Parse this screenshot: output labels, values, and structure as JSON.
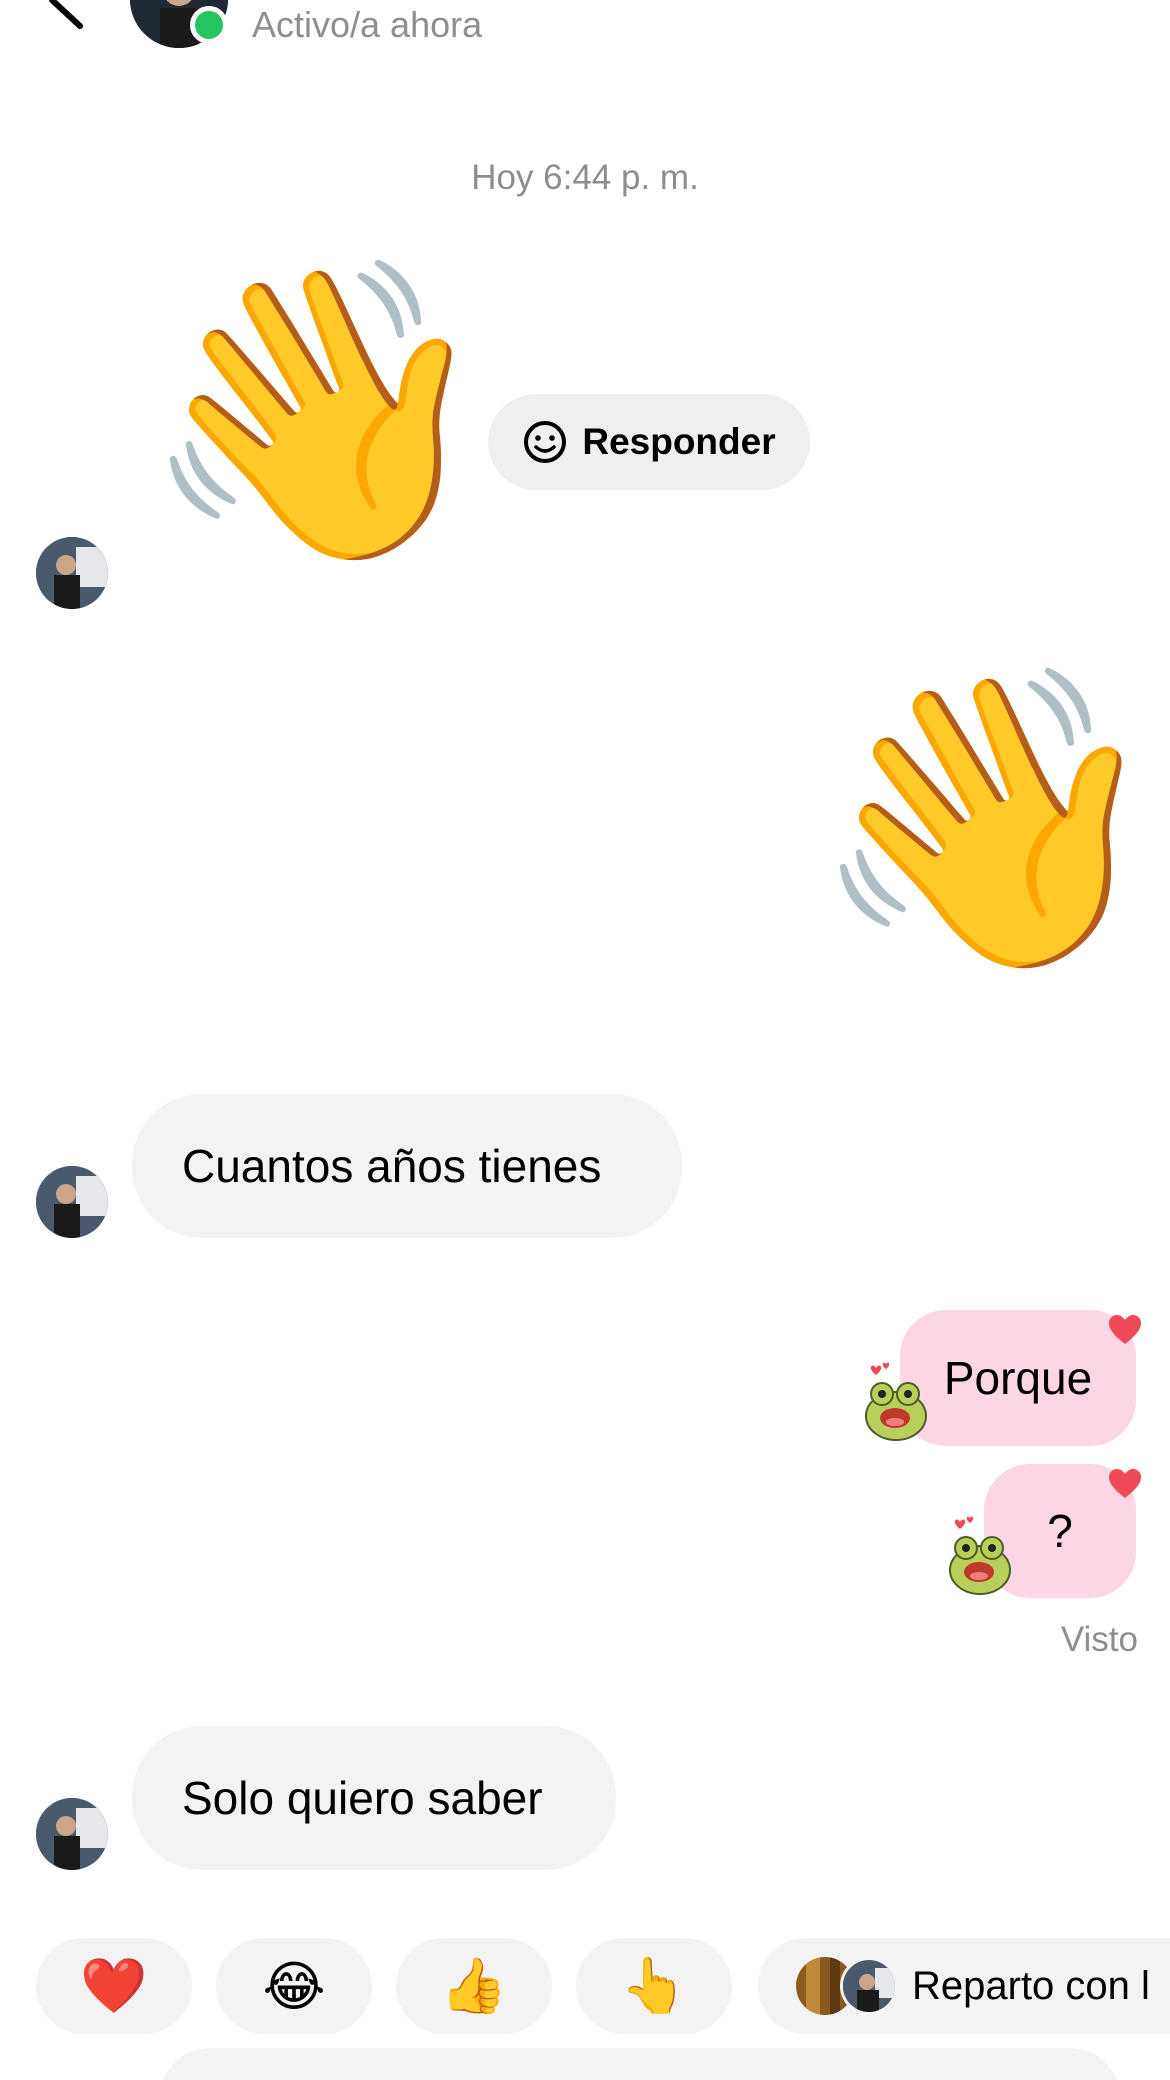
{
  "header": {
    "status": "Activo/a ahora",
    "online_color": "#22c55e",
    "icons": [
      "chevron-left-icon",
      "more-horizontal-icon"
    ]
  },
  "chat": {
    "timestamp": "Hoy 6:44 p. m.",
    "reply_chip_label": "Responder",
    "messages": [
      {
        "from": "them",
        "type": "emoji",
        "content": "👋"
      },
      {
        "from": "me",
        "type": "emoji",
        "content": "👋"
      },
      {
        "from": "them",
        "type": "text",
        "content": "Cuantos años tienes"
      },
      {
        "from": "me",
        "type": "text",
        "content": "Porque",
        "reaction": "heart"
      },
      {
        "from": "me",
        "type": "text",
        "content": "?",
        "reaction": "heart"
      },
      {
        "from": "them",
        "type": "text",
        "content": "Solo quiero saber"
      }
    ],
    "seen": "Visto"
  },
  "quick_reactions": {
    "items": [
      "❤️",
      "😂",
      "👍",
      "👆"
    ],
    "share_label": "Reparto con l"
  },
  "colors": {
    "incoming_bubble": "#f3f3f3",
    "outgoing_bubble": "#fcd6e5",
    "muted_text": "#8e8e8e",
    "heart": "#ed4956"
  }
}
